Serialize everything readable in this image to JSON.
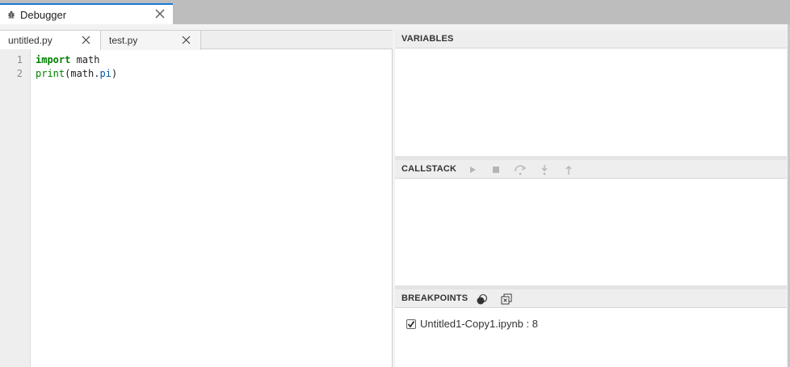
{
  "main_tab": {
    "label": "Debugger",
    "icon": "bug-icon"
  },
  "editor": {
    "tabs": [
      {
        "label": "untitled.py",
        "active": true
      },
      {
        "label": "test.py",
        "active": false
      }
    ],
    "line_numbers": [
      "1",
      "2"
    ],
    "code": {
      "line1_keyword": "import",
      "line1_rest": " math",
      "line2_builtin": "print",
      "line2_mid": "(math.",
      "line2_attr": "pi",
      "line2_end": ")"
    }
  },
  "sidebar": {
    "variables": {
      "title": "VARIABLES"
    },
    "callstack": {
      "title": "CALLSTACK",
      "buttons": [
        "continue-icon",
        "stop-icon",
        "step-over-icon",
        "step-into-icon",
        "step-out-icon"
      ]
    },
    "breakpoints": {
      "title": "BREAKPOINTS",
      "items": [
        {
          "label": "Untitled1-Copy1.ipynb : 8",
          "checked": true
        }
      ]
    }
  },
  "colors": {
    "accent": "#1976d2",
    "keyword": "#008000",
    "attribute": "#0055aa"
  }
}
